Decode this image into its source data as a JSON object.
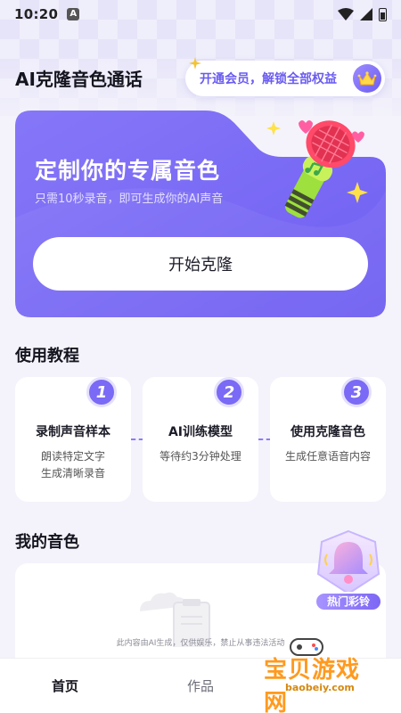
{
  "status_bar": {
    "time": "10:20",
    "notification_glyph": "A"
  },
  "header": {
    "app_title": "AI克隆音色通话",
    "vip_text": "开通会员，解锁全部权益",
    "vip_icon": "crown-icon"
  },
  "hero": {
    "title": "定制你的专属音色",
    "subtitle": "只需10秒录音，即可生成你的AI声音",
    "start_button": "开始克隆",
    "illustration": "microphone-icon",
    "colors": {
      "card": "#7b6cf6",
      "accent_green": "#b9e64a",
      "mic_red": "#ff4a6a"
    }
  },
  "tutorial": {
    "title": "使用教程",
    "steps": [
      {
        "num": "1",
        "title": "录制声音样本",
        "desc_1": "朗读特定文字",
        "desc_2": "生成清晰录音"
      },
      {
        "num": "2",
        "title": "AI训练模型",
        "desc_1": "等待约3分钟处理",
        "desc_2": ""
      },
      {
        "num": "3",
        "title": "使用克隆音色",
        "desc_1": "生成任意语音内容",
        "desc_2": ""
      }
    ]
  },
  "my_voices": {
    "title": "我的音色",
    "disclaimer": "此内容由AI生成，仅供娱乐，禁止从事违法活动"
  },
  "hot_ringtone": {
    "label": "热门彩铃",
    "icon": "bell-icon"
  },
  "tabbar": {
    "tabs": [
      {
        "label": "首页",
        "active": true
      },
      {
        "label": "作品",
        "active": false
      }
    ]
  },
  "watermark": {
    "text": "宝贝游戏网",
    "url": "baobeiy.com"
  }
}
